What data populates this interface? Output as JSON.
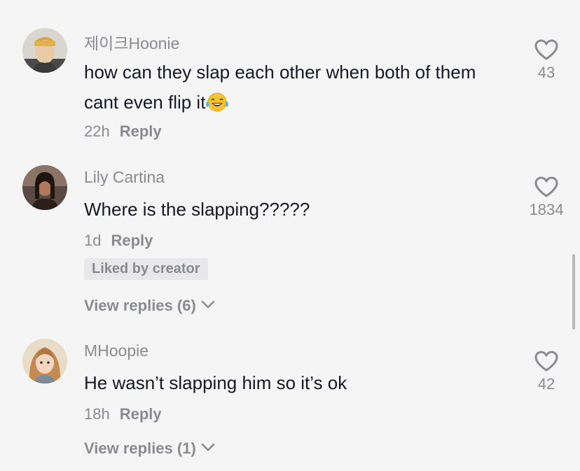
{
  "comments": [
    {
      "username": "제이크Hoonie",
      "text": "how can they slap each other when both of them cant even flip it",
      "emoji_icon": "tears-of-joy-emoji-icon",
      "time": "22h",
      "reply_label": "Reply",
      "likes": "43"
    },
    {
      "username": "Lily Cartina",
      "text": "Where is the slapping?????",
      "time": "1d",
      "reply_label": "Reply",
      "badge": "Liked by creator",
      "view_replies": "View replies (6)",
      "likes": "1834"
    },
    {
      "username": "MHoopie",
      "text": "He wasn’t slapping him so it’s ok",
      "time": "18h",
      "reply_label": "Reply",
      "view_replies": "View replies (1)",
      "likes": "42"
    }
  ],
  "colors": {
    "background": "#f5f5f5",
    "text": "#161823",
    "secondary": "#8a8b91",
    "badge_bg": "#e8e8ea"
  }
}
